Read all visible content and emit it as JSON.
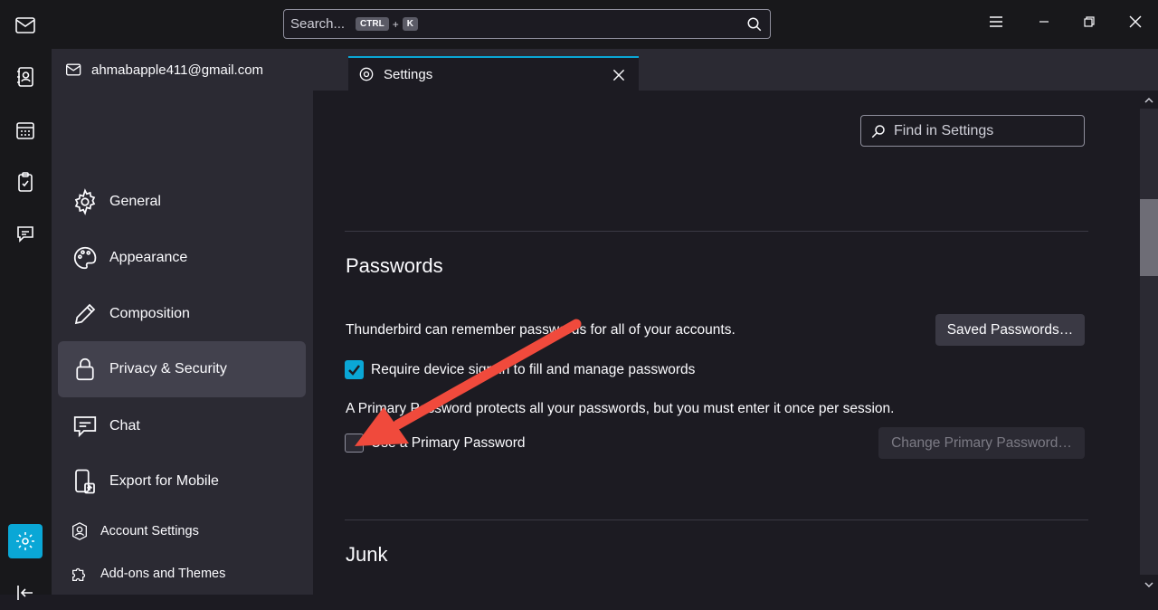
{
  "titlebar": {
    "search_placeholder": "Search...",
    "kbd_ctrl": "CTRL",
    "kbd_plus": "+",
    "kbd_k": "K"
  },
  "tabs": [
    {
      "label": "ahmabapple411@gmail.com"
    },
    {
      "label": "Settings"
    }
  ],
  "sidebar": {
    "items": [
      {
        "label": "General",
        "icon": "gear-icon"
      },
      {
        "label": "Appearance",
        "icon": "palette-icon"
      },
      {
        "label": "Composition",
        "icon": "pencil-icon"
      },
      {
        "label": "Privacy & Security",
        "icon": "lock-icon",
        "selected": true
      },
      {
        "label": "Chat",
        "icon": "chat-icon"
      },
      {
        "label": "Export for Mobile",
        "icon": "mobile-export-icon"
      }
    ],
    "footer": [
      {
        "label": "Account Settings",
        "icon": "account-icon"
      },
      {
        "label": "Add-ons and Themes",
        "icon": "puzzle-icon"
      }
    ]
  },
  "main": {
    "find_placeholder": "Find in Settings",
    "passwords": {
      "heading": "Passwords",
      "remember_text": "Thunderbird can remember passwords for all of your accounts.",
      "saved_passwords_button": "Saved Passwords…",
      "require_signin_label": "Require device sign-in to fill and manage passwords",
      "require_signin_checked": true,
      "primary_text": "A Primary Password protects all your passwords, but you must enter it once per session.",
      "use_primary_label": "Use a Primary Password",
      "use_primary_checked": false,
      "change_primary_button": "Change Primary Password…"
    },
    "junk": {
      "heading": "Junk"
    }
  },
  "colors": {
    "accent": "#0aa7d6",
    "annotation_arrow": "#f04a3c"
  }
}
